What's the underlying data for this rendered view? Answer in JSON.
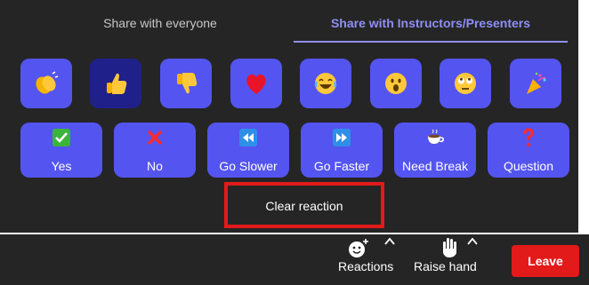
{
  "tabs": {
    "everyone": "Share with everyone",
    "instructors": "Share with Instructors/Presenters"
  },
  "emoji_reactions": [
    {
      "name": "clapping-hands-icon"
    },
    {
      "name": "thumbs-up-icon",
      "selected": true
    },
    {
      "name": "thumbs-down-icon"
    },
    {
      "name": "red-heart-icon"
    },
    {
      "name": "tears-of-joy-icon"
    },
    {
      "name": "surprised-face-icon"
    },
    {
      "name": "eye-roll-face-icon"
    },
    {
      "name": "party-popper-icon"
    }
  ],
  "labeled_reactions": [
    {
      "label": "Yes",
      "icon": "check-mark-icon"
    },
    {
      "label": "No",
      "icon": "cross-mark-icon"
    },
    {
      "label": "Go Slower",
      "icon": "rewind-icon"
    },
    {
      "label": "Go Faster",
      "icon": "fast-forward-icon"
    },
    {
      "label": "Need Break",
      "icon": "coffee-cup-icon"
    },
    {
      "label": "Question",
      "icon": "question-mark-icon"
    }
  ],
  "clear_reaction": "Clear reaction",
  "bottom_bar": {
    "reactions_label": "Reactions",
    "raise_hand_label": "Raise hand",
    "leave_label": "Leave"
  },
  "colors": {
    "panel": "#252525",
    "accent": "#5454f0",
    "selected": "#20208a",
    "tab_active": "#8f8ff5",
    "highlight": "#e21a1a"
  }
}
